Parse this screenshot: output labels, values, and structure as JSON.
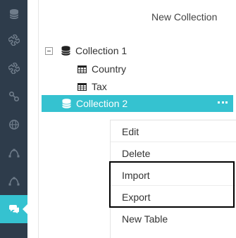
{
  "sidebar": {
    "icons": [
      "database-icon",
      "puzzle-icon",
      "puzzle-alt-icon",
      "link-icon",
      "globe-icon",
      "vector-icon",
      "vector-alt-icon",
      "chat-icon"
    ],
    "active_index": 7,
    "colors": {
      "background": "#2e3c4b",
      "icon": "#6f7c8a",
      "active": "#35c2d0"
    }
  },
  "header": {
    "new_collection_label": "New Collection"
  },
  "tree": {
    "collection1": {
      "label": "Collection 1",
      "tables": [
        "Country",
        "Tax"
      ]
    },
    "collection2": {
      "label": "Collection 2"
    },
    "selected_color": "#35c2d0"
  },
  "context_menu": {
    "items": [
      "Edit",
      "Delete",
      "Import",
      "Export",
      "New Table"
    ]
  }
}
